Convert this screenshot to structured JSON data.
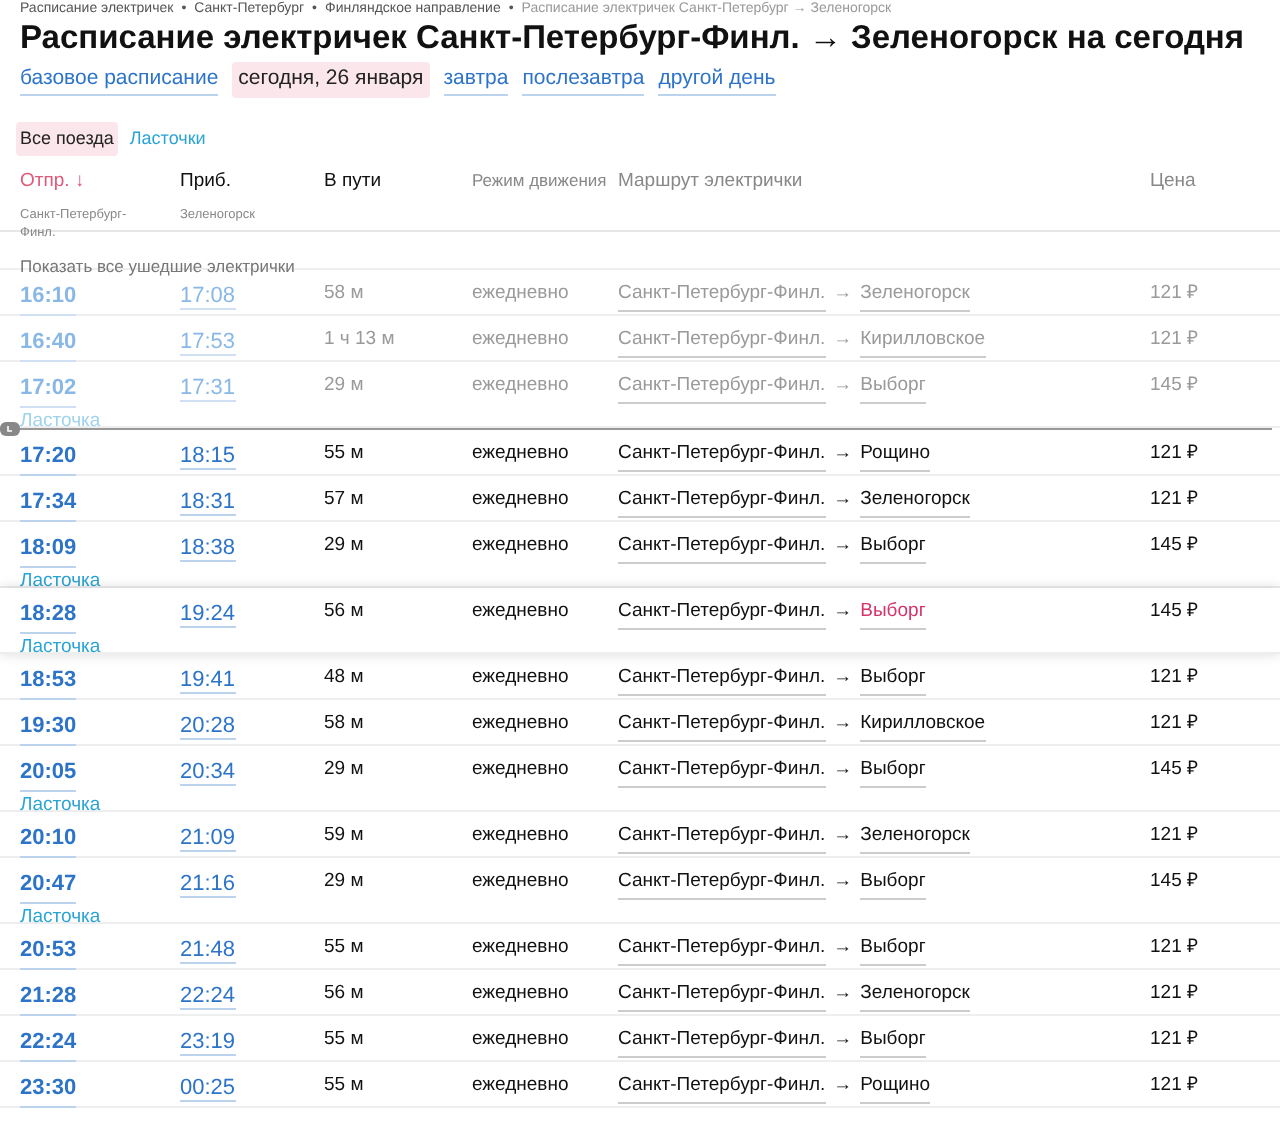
{
  "breadcrumbs": [
    {
      "label": "Расписание электричек"
    },
    {
      "separator": "•",
      "label": "Санкт-Петербург"
    },
    {
      "separator": "•",
      "label": "Финляндское направление"
    },
    {
      "separator": "•",
      "label": "Расписание электричек Санкт-Петербург → Зеленогорск"
    }
  ],
  "title": "Расписание электричек Санкт-Петербург-Финл. → Зеленогорск на сегодня",
  "day_links": [
    {
      "label": "базовое расписание",
      "selected": false
    },
    {
      "label": "сегодня, 26 января",
      "selected": true
    },
    {
      "label": "завтра",
      "selected": false
    },
    {
      "label": "послезавтра",
      "selected": false
    },
    {
      "label": "другой день",
      "selected": false
    }
  ],
  "filters": [
    {
      "label": "Все поезда",
      "selected": true
    },
    {
      "label": "Ласточки",
      "selected": false
    }
  ],
  "columns": {
    "departure": {
      "label": "Отпр.",
      "sort": "↓",
      "station": "Санкт-Петербург-Финл."
    },
    "arrival": {
      "label": "Приб.",
      "station": "Зеленогорск"
    },
    "duration": "В пути",
    "mode": "Режим движения",
    "route": "Маршрут электрички",
    "price": "Цена"
  },
  "show_departed": "Показать все ушедшие электрички",
  "rows": [
    {
      "departure": "16:10",
      "arrival": "17:08",
      "duration": "58 м",
      "mode": "ежедневно",
      "route_from": "Санкт-Петербург-Финл.",
      "route_sep": "→",
      "route_to": "Зеленогорск",
      "price": "121 ₽",
      "departed": true,
      "highlighted": false
    },
    {
      "departure": "16:40",
      "arrival": "17:53",
      "duration": "1 ч 13 м",
      "mode": "ежедневно",
      "route_from": "Санкт-Петербург-Финл.",
      "route_sep": "→",
      "route_to": "Кирилловское",
      "price": "121 ₽",
      "departed": true,
      "highlighted": false
    },
    {
      "departure": "17:02",
      "arrival": "17:31",
      "duration": "29 м",
      "mode": "ежедневно",
      "route_from": "Санкт-Петербург-Финл.",
      "route_sep": "→",
      "route_to": "Выборг",
      "price": "145 ₽",
      "train_type": "Ласточка",
      "departed": true,
      "highlighted": false
    },
    {
      "departure": "17:20",
      "arrival": "18:15",
      "duration": "55 м",
      "mode": "ежедневно",
      "route_from": "Санкт-Петербург-Финл.",
      "route_sep": "→",
      "route_to": "Рощино",
      "price": "121 ₽",
      "departed": false,
      "highlighted": false
    },
    {
      "departure": "17:34",
      "arrival": "18:31",
      "duration": "57 м",
      "mode": "ежедневно",
      "route_from": "Санкт-Петербург-Финл.",
      "route_sep": "→",
      "route_to": "Зеленогорск",
      "price": "121 ₽",
      "departed": false,
      "highlighted": false
    },
    {
      "departure": "18:09",
      "arrival": "18:38",
      "duration": "29 м",
      "mode": "ежедневно",
      "route_from": "Санкт-Петербург-Финл.",
      "route_sep": "→",
      "route_to": "Выборг",
      "price": "145 ₽",
      "train_type": "Ласточка",
      "departed": false,
      "highlighted": false
    },
    {
      "departure": "18:28",
      "arrival": "19:24",
      "duration": "56 м",
      "mode": "ежедневно",
      "route_from": "Санкт-Петербург-Финл.",
      "route_sep": "→",
      "route_to": "Выборг",
      "price": "145 ₽",
      "train_type": "Ласточка",
      "departed": false,
      "highlighted": true
    },
    {
      "departure": "18:53",
      "arrival": "19:41",
      "duration": "48 м",
      "mode": "ежедневно",
      "route_from": "Санкт-Петербург-Финл.",
      "route_sep": "→",
      "route_to": "Выборг",
      "price": "121 ₽",
      "departed": false,
      "highlighted": false
    },
    {
      "departure": "19:30",
      "arrival": "20:28",
      "duration": "58 м",
      "mode": "ежедневно",
      "route_from": "Санкт-Петербург-Финл.",
      "route_sep": "→",
      "route_to": "Кирилловское",
      "price": "121 ₽",
      "departed": false,
      "highlighted": false
    },
    {
      "departure": "20:05",
      "arrival": "20:34",
      "duration": "29 м",
      "mode": "ежедневно",
      "route_from": "Санкт-Петербург-Финл.",
      "route_sep": "→",
      "route_to": "Выборг",
      "price": "145 ₽",
      "train_type": "Ласточка",
      "departed": false,
      "highlighted": false
    },
    {
      "departure": "20:10",
      "arrival": "21:09",
      "duration": "59 м",
      "mode": "ежедневно",
      "route_from": "Санкт-Петербург-Финл.",
      "route_sep": "→",
      "route_to": "Зеленогорск",
      "price": "121 ₽",
      "departed": false,
      "highlighted": false
    },
    {
      "departure": "20:47",
      "arrival": "21:16",
      "duration": "29 м",
      "mode": "ежедневно",
      "route_from": "Санкт-Петербург-Финл.",
      "route_sep": "→",
      "route_to": "Выборг",
      "price": "145 ₽",
      "train_type": "Ласточка",
      "departed": false,
      "highlighted": false
    },
    {
      "departure": "20:53",
      "arrival": "21:48",
      "duration": "55 м",
      "mode": "ежедневно",
      "route_from": "Санкт-Петербург-Финл.",
      "route_sep": "→",
      "route_to": "Выборг",
      "price": "121 ₽",
      "departed": false,
      "highlighted": false
    },
    {
      "departure": "21:28",
      "arrival": "22:24",
      "duration": "56 м",
      "mode": "ежедневно",
      "route_from": "Санкт-Петербург-Финл.",
      "route_sep": "→",
      "route_to": "Зеленогорск",
      "price": "121 ₽",
      "departed": false,
      "highlighted": false
    },
    {
      "departure": "22:24",
      "arrival": "23:19",
      "duration": "55 м",
      "mode": "ежедневно",
      "route_from": "Санкт-Петербург-Финл.",
      "route_sep": "→",
      "route_to": "Выборг",
      "price": "121 ₽",
      "departed": false,
      "highlighted": false
    },
    {
      "departure": "23:30",
      "arrival": "00:25",
      "duration": "55 м",
      "mode": "ежедневно",
      "route_from": "Санкт-Петербург-Финл.",
      "route_sep": "→",
      "route_to": "Рощино",
      "price": "121 ₽",
      "departed": false,
      "highlighted": false
    }
  ]
}
